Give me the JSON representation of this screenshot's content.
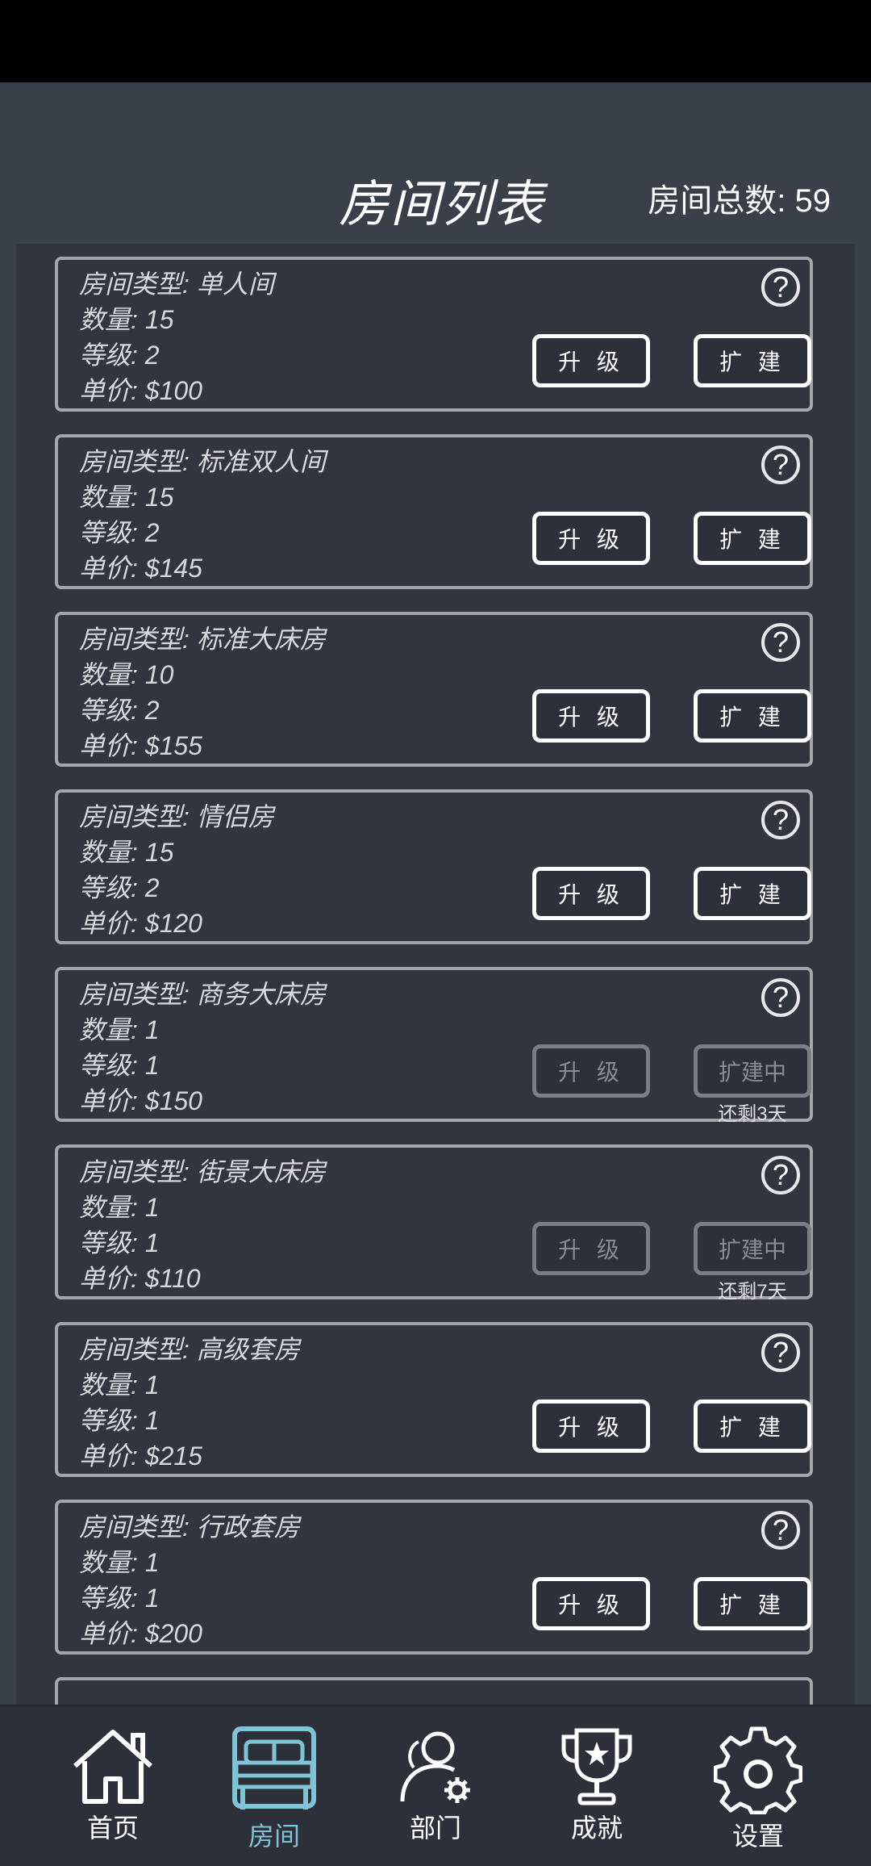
{
  "header": {
    "title": "房间列表",
    "total_label": "房间总数: 59"
  },
  "labels": {
    "upgrade": "升 级",
    "expand": "扩 建",
    "expanding": "扩建中",
    "help": "?"
  },
  "rooms": [
    {
      "type": "房间类型: 单人间",
      "count": "数量: 15",
      "level": "等级: 2",
      "price": "单价: $100",
      "status": "normal",
      "countdown": ""
    },
    {
      "type": "房间类型: 标准双人间",
      "count": "数量: 15",
      "level": "等级: 2",
      "price": "单价: $145",
      "status": "normal",
      "countdown": ""
    },
    {
      "type": "房间类型: 标准大床房",
      "count": "数量: 10",
      "level": "等级: 2",
      "price": "单价: $155",
      "status": "normal",
      "countdown": ""
    },
    {
      "type": "房间类型: 情侣房",
      "count": "数量: 15",
      "level": "等级: 2",
      "price": "单价: $120",
      "status": "normal",
      "countdown": ""
    },
    {
      "type": "房间类型: 商务大床房",
      "count": "数量: 1",
      "level": "等级: 1",
      "price": "单价: $150",
      "status": "expanding",
      "countdown": "还剩3天"
    },
    {
      "type": "房间类型: 街景大床房",
      "count": "数量: 1",
      "level": "等级: 1",
      "price": "单价: $110",
      "status": "expanding",
      "countdown": "还剩7天"
    },
    {
      "type": "房间类型: 高级套房",
      "count": "数量: 1",
      "level": "等级: 1",
      "price": "单价: $215",
      "status": "normal",
      "countdown": ""
    },
    {
      "type": "房间类型: 行政套房",
      "count": "数量: 1",
      "level": "等级: 1",
      "price": "单价: $200",
      "status": "normal",
      "countdown": ""
    }
  ],
  "tabs": [
    {
      "label": "首页",
      "icon": "home-icon",
      "active": false
    },
    {
      "label": "房间",
      "icon": "bed-icon",
      "active": true
    },
    {
      "label": "部门",
      "icon": "staff-settings-icon",
      "active": false
    },
    {
      "label": "成就",
      "icon": "trophy-icon",
      "active": false
    },
    {
      "label": "设置",
      "icon": "gear-icon",
      "active": false
    }
  ],
  "colors": {
    "background": "#3a3f4a",
    "panel": "#32343e",
    "card_border": "#a6a6aa",
    "active_tab": "#7ec3d6",
    "disabled": "#7c7e86"
  }
}
